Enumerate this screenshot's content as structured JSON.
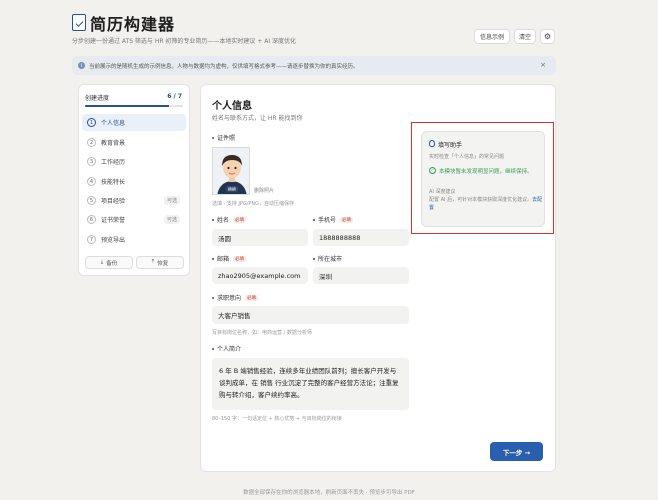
{
  "header": {
    "title": "简历构建器",
    "subtitle": "分步创建一份通过 ATS 筛选与 HR 初筛的专业简历——本地实时建议 + AI 深度优化",
    "sample_label": "信息示例",
    "clear_label": "清空",
    "settings_icon": "gear-icon"
  },
  "notice": {
    "text": "当前展示的是随机生成的示例信息。人物与数据均为虚构，仅供填写格式参考——请逐步替换为你的真实经历。",
    "close": "×"
  },
  "sidebar": {
    "title": "创建进度",
    "count": "6 / 7",
    "progress": 0.857,
    "steps": [
      {
        "num": "1",
        "label": "个人信息",
        "optional": ""
      },
      {
        "num": "2",
        "label": "教育背景",
        "optional": ""
      },
      {
        "num": "3",
        "label": "工作经历",
        "optional": ""
      },
      {
        "num": "4",
        "label": "技能特长",
        "optional": ""
      },
      {
        "num": "5",
        "label": "项目经验",
        "optional": "可选"
      },
      {
        "num": "6",
        "label": "证书荣誉",
        "optional": "可选"
      },
      {
        "num": "7",
        "label": "预览导出",
        "optional": ""
      }
    ],
    "backup_label": "备份",
    "restore_label": "恢复"
  },
  "main": {
    "title": "个人信息",
    "subtitle": "姓名与联系方式，让 HR 能找到你",
    "photo_label": "证件照",
    "photo_badge": "换换",
    "photo_delete": "删除照片",
    "photo_hint": "选填 · 支持 JPG/PNG，自动压缩保存",
    "required": "必填",
    "name_label": "姓名",
    "name_value": "汤圆",
    "phone_label": "手机号",
    "phone_value": "1888888888",
    "email_label": "邮箱",
    "email_value": "zhao2905@example.com",
    "city_label": "所在城市",
    "city_value": "深圳",
    "job_label": "求职意向",
    "job_value": "大客户销售",
    "job_hint": "写目标岗位名称，如：电商运营 / 数据分析师",
    "intro_label": "个人简介",
    "intro_value": "6 年 B 端销售经验，连续多年业绩团队前列；擅长客户开发与谈判成单，在 销售 行业沉淀了完整的客户经营方法论；注重复购与转介绍，客户续约率高。",
    "intro_hint": "80–150 字：一句话定位 + 核心优势 + 与目标岗位的衔接",
    "next_label": "下一步 →"
  },
  "helper": {
    "title": "填写助手",
    "subtitle": "实时检查「个人信息」的常见问题",
    "ok_text": "本模块暂未发现明显问题，继续保持。",
    "ai_title": "AI 深度建议",
    "ai_desc": "配置 AI 后，可针对本模块获取深度优化建议。",
    "ai_link": "去配置"
  },
  "footer": "数据全部保存在你的浏览器本地，刷新页面不丢失 · 预览步可导出 PDF"
}
